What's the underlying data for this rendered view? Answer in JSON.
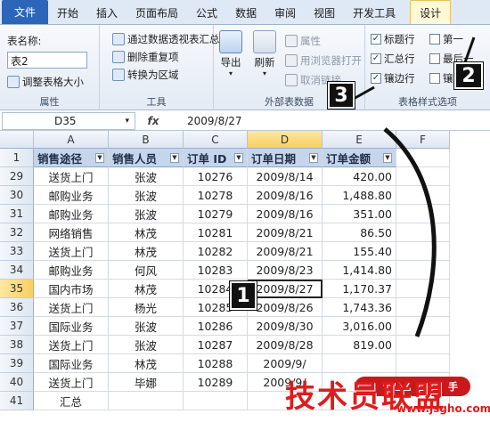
{
  "tabs": [
    "文件",
    "开始",
    "插入",
    "页面布局",
    "公式",
    "数据",
    "审阅",
    "视图",
    "开发工具",
    "设计"
  ],
  "ribbon": {
    "properties": {
      "name_label": "表名称:",
      "name_value": "表2",
      "resize_label": "调整表格大小",
      "group_label": "属性"
    },
    "tools": {
      "items": [
        "通过数据透视表汇总",
        "删除重复项",
        "转换为区域"
      ],
      "group_label": "工具"
    },
    "external": {
      "export_label": "导出",
      "refresh_label": "刷新",
      "items": [
        "属性",
        "用浏览器打开",
        "取消链接"
      ],
      "group_label": "外部表数据"
    },
    "style_options": {
      "col1": [
        {
          "label": "标题行",
          "checked": true
        },
        {
          "label": "汇总行",
          "checked": true
        },
        {
          "label": "镶边行",
          "checked": true
        }
      ],
      "col2": [
        {
          "label": "第一",
          "checked": false
        },
        {
          "label": "最后一",
          "checked": false
        },
        {
          "label": "镶",
          "checked": false
        }
      ],
      "group_label": "表格样式选项"
    }
  },
  "formula_bar": {
    "cell_ref": "D35",
    "fx": "fx",
    "value": "2009/8/27"
  },
  "sheet": {
    "columns": [
      "A",
      "B",
      "C",
      "D",
      "E",
      "F"
    ],
    "selected_column": "D",
    "header_row_number": "1",
    "headers": [
      "销售途径",
      "销售人员",
      "订单 ID",
      "订单日期",
      "订单金额"
    ],
    "rows": [
      {
        "n": "29",
        "cells": [
          "送货上门",
          "张波",
          "10276",
          "2009/8/14",
          "420.00"
        ]
      },
      {
        "n": "30",
        "cells": [
          "邮购业务",
          "张波",
          "10278",
          "2009/8/16",
          "1,488.80"
        ]
      },
      {
        "n": "31",
        "cells": [
          "邮购业务",
          "张波",
          "10279",
          "2009/8/16",
          "351.00"
        ]
      },
      {
        "n": "32",
        "cells": [
          "网络销售",
          "林茂",
          "10281",
          "2009/8/21",
          "86.50"
        ]
      },
      {
        "n": "33",
        "cells": [
          "送货上门",
          "林茂",
          "10282",
          "2009/8/21",
          "155.40"
        ]
      },
      {
        "n": "34",
        "cells": [
          "邮购业务",
          "何风",
          "10283",
          "2009/8/23",
          "1,414.80"
        ]
      },
      {
        "n": "35",
        "cells": [
          "国内市场",
          "林茂",
          "10284",
          "2009/8/27",
          "1,170.37"
        ]
      },
      {
        "n": "36",
        "cells": [
          "送货上门",
          "杨光",
          "10285",
          "2009/8/26",
          "1,743.36"
        ]
      },
      {
        "n": "37",
        "cells": [
          "国际业务",
          "张波",
          "10286",
          "2009/8/30",
          "3,016.00"
        ]
      },
      {
        "n": "38",
        "cells": [
          "送货上门",
          "张波",
          "10287",
          "2009/8/28",
          "819.00"
        ]
      },
      {
        "n": "39",
        "cells": [
          "国际业务",
          "林茂",
          "10288",
          "2009/9/",
          ""
        ]
      },
      {
        "n": "40",
        "cells": [
          "送货上门",
          "毕娜",
          "10289",
          "2009/9/",
          ""
        ]
      },
      {
        "n": "41",
        "cells": [
          "汇总",
          "",
          "",
          "",
          ""
        ]
      }
    ],
    "selected_row": "35"
  },
  "callouts": [
    "1",
    "2",
    "3"
  ],
  "watermark": {
    "main": "技术员联盟",
    "sub": "www.jsgho.com",
    "tag": "手"
  },
  "colors": {
    "file_tab": "#2b66b8",
    "table_header": "#c5d5eb",
    "selected_header": "#f8cf5f",
    "watermark": "#e11b1b"
  }
}
